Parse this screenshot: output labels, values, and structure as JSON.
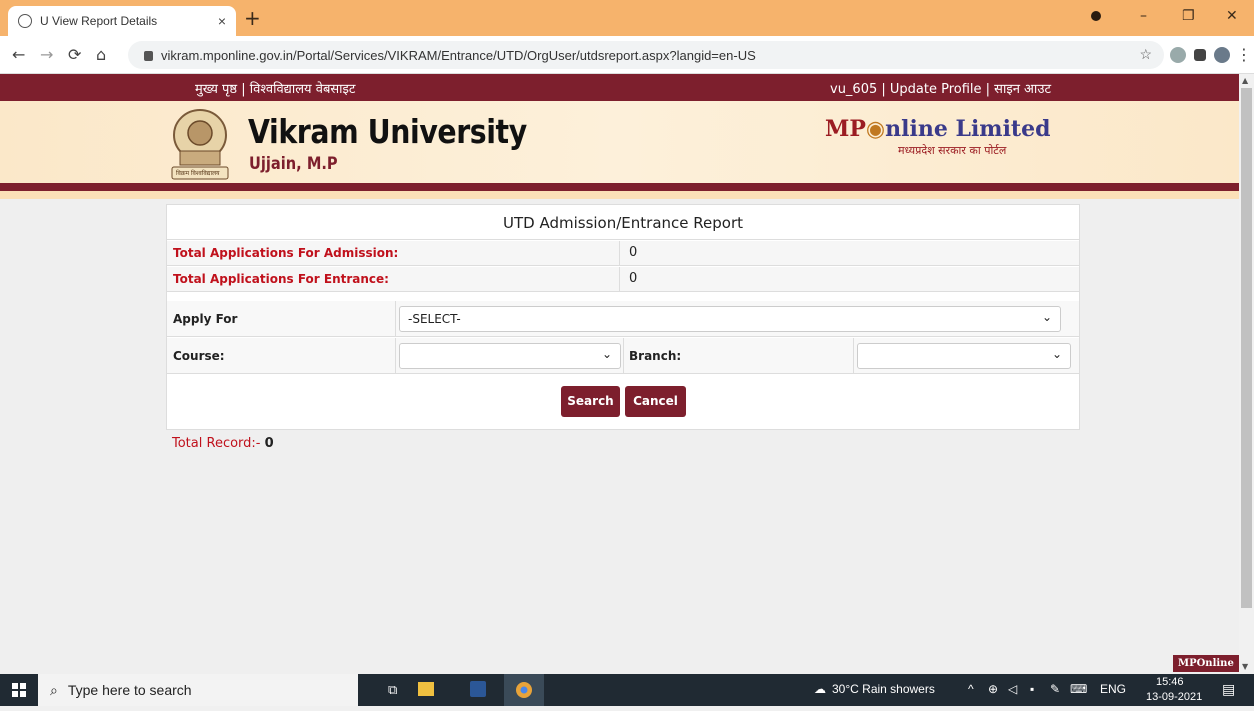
{
  "browser": {
    "tab_title": "U View Report Details",
    "tab_close": "×",
    "new_tab": "+",
    "url": "vikram.mponline.gov.in/Portal/Services/VIKRAM/Entrance/UTD/OrgUser/utdsreport.aspx?langid=en-US",
    "window_controls": {
      "minimize": "–",
      "restore": "❐",
      "close": "✕"
    }
  },
  "topbar": {
    "left_text": "मुख्य पृष्ठ | विश्वविद्यालय वेबसाइट",
    "right_text": "vu_605 |  Update Profile | साइन आउट"
  },
  "header": {
    "university": "Vikram University",
    "city": "Ujjain, M.P",
    "emblem_text": "विक्रम विश्वविद्यालय",
    "partner_logo_mp": "MP",
    "partner_logo_online": "nline Limited",
    "partner_tagline": "मध्यप्रदेश सरकार का पोर्टल"
  },
  "report": {
    "title": "UTD Admission/Entrance Report",
    "admission_label": "Total Applications For Admission:",
    "admission_value": "0",
    "entrance_label": "Total Applications For Entrance:",
    "entrance_value": "0",
    "apply_for_label": "Apply For",
    "apply_for_value": "-SELECT-",
    "course_label": "Course:",
    "course_value": "",
    "branch_label": "Branch:",
    "branch_value": "",
    "search_label": "Search",
    "cancel_label": "Cancel"
  },
  "total_record": {
    "label": "Total Record:- ",
    "value": "0"
  },
  "badge": "MPOnline",
  "taskbar": {
    "search_placeholder": "Type here to search",
    "weather": "30°C  Rain showers",
    "lang": "ENG",
    "time": "15:46",
    "date": "13-09-2021"
  }
}
